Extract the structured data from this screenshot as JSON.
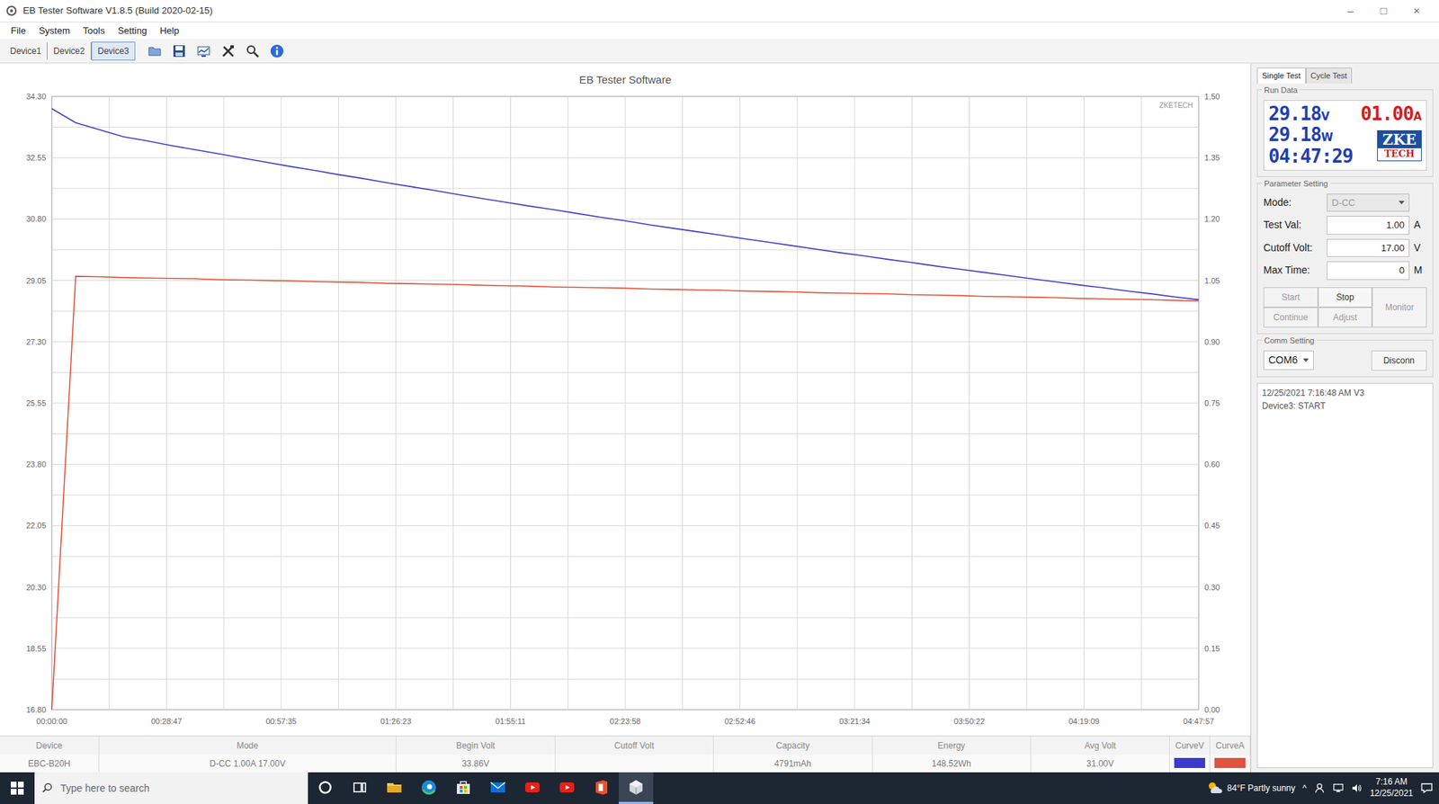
{
  "window": {
    "title": "EB Tester Software V1.8.5 (Build 2020-02-15)",
    "controls": [
      "–",
      "□",
      "×"
    ]
  },
  "menu": [
    "File",
    "System",
    "Tools",
    "Setting",
    "Help"
  ],
  "device_tabs": [
    {
      "label": "Device1",
      "selected": false
    },
    {
      "label": "Device2",
      "selected": false
    },
    {
      "label": "Device3",
      "selected": true
    }
  ],
  "toolbar": [
    {
      "kind": "open"
    },
    {
      "kind": "save"
    },
    {
      "kind": "chart"
    },
    {
      "kind": "tools"
    },
    {
      "kind": "search"
    },
    {
      "kind": "info"
    }
  ],
  "chart": {
    "title": "EB Tester Software",
    "watermark": "ZKETECH",
    "y_left_ticks": [
      "34.30",
      "32.55",
      "30.80",
      "29.05",
      "27.30",
      "25.55",
      "23.80",
      "22.05",
      "20.30",
      "18.55",
      "16.80"
    ],
    "y_right_ticks": [
      "1.50",
      "1.35",
      "1.20",
      "1.05",
      "0.90",
      "0.75",
      "0.60",
      "0.45",
      "0.30",
      "0.15",
      "0.00"
    ],
    "x_ticks": [
      "00:00:00",
      "00:28:47",
      "00:57:35",
      "01:26:23",
      "01:55:11",
      "02:23:58",
      "02:52:46",
      "03:21:34",
      "03:50:22",
      "04:19:09",
      "04:47:57"
    ],
    "series": [
      {
        "axis": "left",
        "color": "#3b3bcc",
        "values": [
          33.95,
          33.55,
          33.35,
          33.15,
          33.03,
          32.9,
          32.78,
          32.66,
          32.54,
          32.42,
          32.3,
          32.19,
          32.07,
          31.96,
          31.84,
          31.73,
          31.62,
          31.5,
          31.39,
          31.28,
          31.17,
          31.07,
          30.96,
          30.85,
          30.75,
          30.64,
          30.54,
          30.44,
          30.34,
          30.24,
          30.14,
          30.04,
          29.94,
          29.84,
          29.75,
          29.65,
          29.56,
          29.46,
          29.37,
          29.28,
          29.19,
          29.1,
          29.01,
          28.92,
          28.84,
          28.75,
          28.67,
          28.58,
          28.5
        ]
      },
      {
        "axis": "right",
        "color": "#e0533c",
        "values": [
          0.0,
          1.06,
          1.059,
          1.057,
          1.056,
          1.055,
          1.054,
          1.052,
          1.051,
          1.05,
          1.049,
          1.047,
          1.046,
          1.045,
          1.043,
          1.042,
          1.041,
          1.04,
          1.038,
          1.037,
          1.036,
          1.034,
          1.033,
          1.032,
          1.031,
          1.029,
          1.028,
          1.027,
          1.026,
          1.024,
          1.023,
          1.022,
          1.02,
          1.019,
          1.018,
          1.017,
          1.015,
          1.014,
          1.013,
          1.011,
          1.01,
          1.009,
          1.008,
          1.006,
          1.005,
          1.004,
          1.003,
          1.001,
          1.0
        ]
      }
    ]
  },
  "panel": {
    "tabs": [
      {
        "label": "Single Test",
        "selected": true
      },
      {
        "label": "Cycle Test",
        "selected": false
      }
    ],
    "run_data": {
      "title": "Run Data",
      "voltage": "29.18",
      "voltage_unit": "V",
      "current": "01.00",
      "current_unit": "A",
      "power": "29.18",
      "power_unit": "W",
      "time": "04:47:29"
    },
    "logo": [
      "ZKE",
      "TECH"
    ],
    "parameters": {
      "title": "Parameter Setting",
      "fields": [
        {
          "label": "Mode:",
          "value": "D-CC",
          "unit": "",
          "kind": "select",
          "disabled": true
        },
        {
          "label": "Test Val:",
          "value": "1.00",
          "unit": "A",
          "kind": "input",
          "disabled": false
        },
        {
          "label": "Cutoff Volt:",
          "value": "17.00",
          "unit": "V",
          "kind": "input",
          "disabled": false
        },
        {
          "label": "Max Time:",
          "value": "0",
          "unit": "M",
          "kind": "input",
          "disabled": false
        }
      ]
    },
    "buttons": [
      {
        "label": "Start",
        "disabled": true
      },
      {
        "label": "Stop",
        "disabled": false
      },
      {
        "label": "Continue",
        "disabled": true
      },
      {
        "label": "Adjust",
        "disabled": true
      },
      {
        "label": "Monitor",
        "disabled": true
      }
    ],
    "comm": {
      "title": "Comm Setting",
      "port": "COM6",
      "button": "Disconn"
    },
    "log": [
      "12/25/2021 7:16:48 AM V3",
      "Device3: START"
    ]
  },
  "table": {
    "columns": [
      "Device",
      "Mode",
      "Begin Volt",
      "Cutoff Volt",
      "Capacity",
      "Energy",
      "Avg Volt",
      "CurveV",
      "CurveA"
    ],
    "rows": [
      [
        "EBC-B20H",
        "D-CC 1.00A 17.00V",
        "33.86V",
        "",
        "4791mAh",
        "148.52Wh",
        "31.00V"
      ]
    ]
  },
  "taskbar": {
    "search": {
      "placeholder": "Type here to search"
    },
    "apps": [
      {
        "kind": "cortana",
        "selected": false
      },
      {
        "kind": "taskview",
        "selected": false
      },
      {
        "kind": "explorer",
        "selected": false
      },
      {
        "kind": "edge",
        "selected": false
      },
      {
        "kind": "store",
        "selected": false
      },
      {
        "kind": "mail",
        "selected": false
      },
      {
        "kind": "youtube",
        "selected": false
      },
      {
        "kind": "youtube",
        "selected": false
      },
      {
        "kind": "office",
        "selected": false
      },
      {
        "kind": "app",
        "selected": true
      }
    ],
    "weather": "84°F Partly sunny",
    "tray_caret": "^",
    "tray": [
      {
        "kind": "people"
      },
      {
        "kind": "network"
      },
      {
        "kind": "volume"
      }
    ],
    "time": "7:16 AM",
    "date": "12/25/2021"
  }
}
